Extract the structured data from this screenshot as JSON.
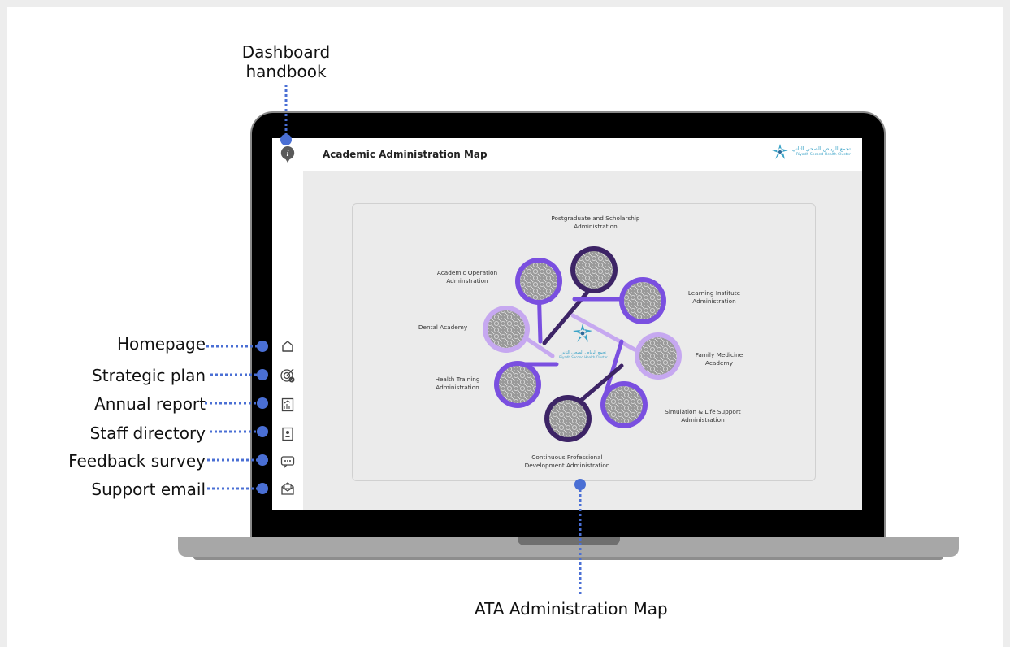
{
  "callouts": {
    "dashboard_handbook": [
      "Dashboard",
      "handbook"
    ],
    "homepage": "Homepage",
    "strategic_plan": "Strategic plan",
    "annual_report": "Annual report",
    "staff_directory": "Staff directory",
    "feedback_survey": "Feedback survey",
    "support_email": "Support email",
    "ata_map": "ATA Administration Map"
  },
  "screen": {
    "page_title": "Academic Administration Map",
    "logo_arabic": "تجمع الرياض الصحي الثاني",
    "logo_english": "Riyadh Second Health Cluster"
  },
  "sidebar_icons": [
    "info-icon",
    "home-icon",
    "target-icon",
    "report-icon",
    "directory-icon",
    "chat-icon",
    "mail-icon"
  ],
  "map": {
    "center_arabic": "تجمع الرياض الصحي الثاني",
    "center_english": "Riyadh Second Health Cluster",
    "nodes": [
      {
        "label1": "Postgraduate and Scholarship",
        "label2": "Administration"
      },
      {
        "label1": "Learning Institute",
        "label2": "Administration"
      },
      {
        "label1": "Family Medicine",
        "label2": "Academy"
      },
      {
        "label1": "Simulation & Life Support",
        "label2": "Administration"
      },
      {
        "label1": "Continuous Professional",
        "label2": "Development Administration"
      },
      {
        "label1": "Health Training",
        "label2": "Administration"
      },
      {
        "label1": "Dental Academy",
        "label2": ""
      },
      {
        "label1": "Academic Operation",
        "label2": "Adminstration"
      }
    ]
  },
  "colors": {
    "accent_blue": "#4a6fd4",
    "purple_dark": "#3d2466",
    "purple_mid": "#7a4fe0",
    "purple_light": "#c6a8f0"
  }
}
